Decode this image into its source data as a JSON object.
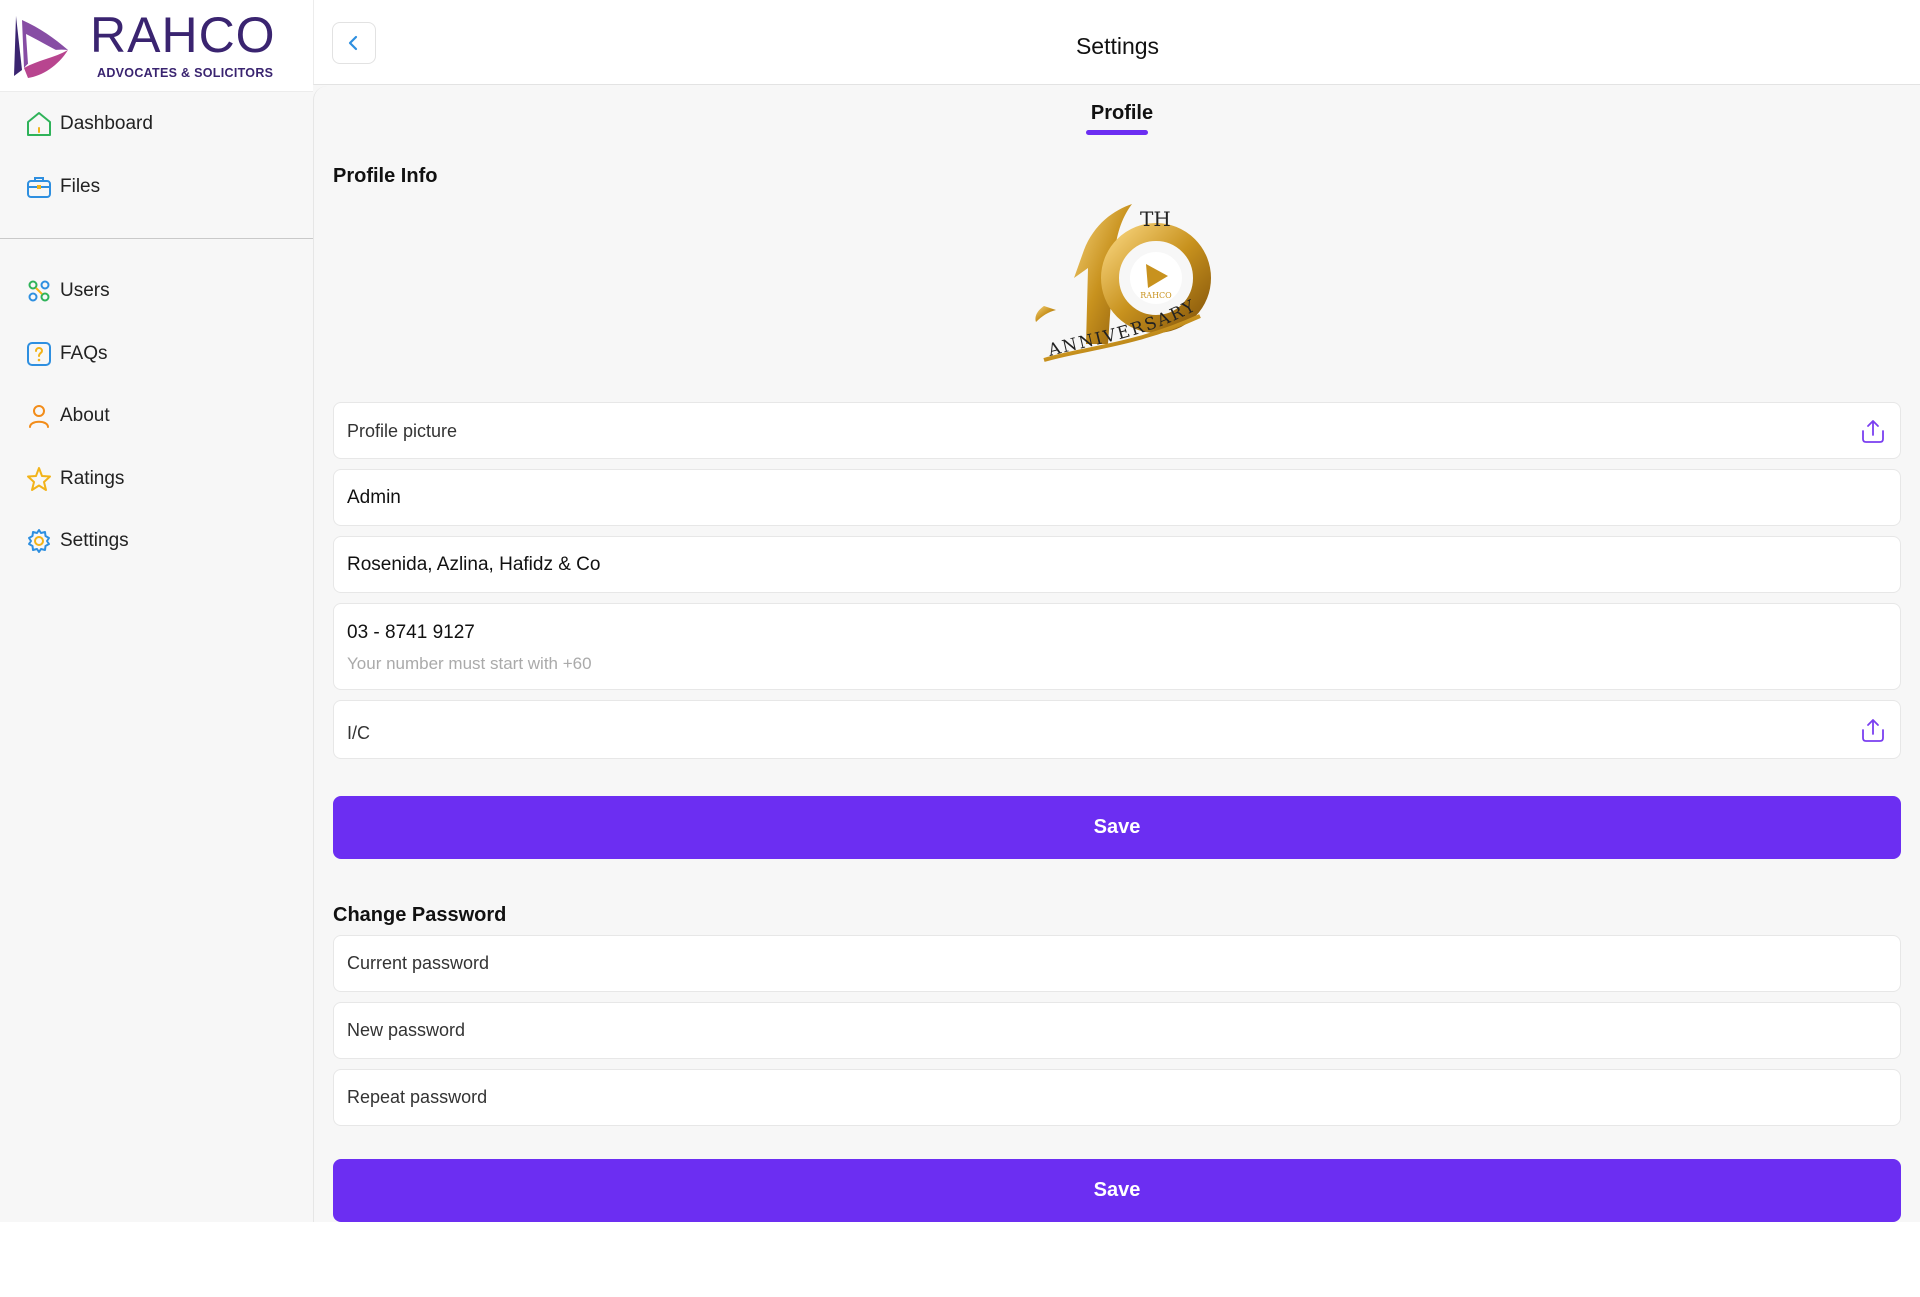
{
  "brand": {
    "name": "RAHCO",
    "subtitle": "ADVOCATES & SOLICITORS"
  },
  "sidebar": {
    "primary": [
      {
        "label": "Dashboard",
        "icon": "home-icon"
      },
      {
        "label": "Files",
        "icon": "briefcase-icon"
      }
    ],
    "secondary": [
      {
        "label": "Users",
        "icon": "users-icon"
      },
      {
        "label": "FAQs",
        "icon": "faq-icon"
      },
      {
        "label": "About",
        "icon": "person-icon"
      },
      {
        "label": "Ratings",
        "icon": "star-icon"
      },
      {
        "label": "Settings",
        "icon": "gear-icon"
      }
    ]
  },
  "header": {
    "title": "Settings"
  },
  "tabs": [
    {
      "label": "Profile",
      "active": true
    }
  ],
  "profile": {
    "section_title": "Profile Info",
    "avatar": {
      "text_top": "TH",
      "text_center": "RAHCO",
      "text_bottom": "ANNIVERSARY",
      "number": "10"
    },
    "picture_label": "Profile picture",
    "name": "Admin",
    "firm": "Rosenida, Azlina, Hafidz & Co",
    "phone": "03 - 8741 9127",
    "phone_hint": "Your number must start with +60",
    "ic_label": "I/C",
    "save_label": "Save"
  },
  "password": {
    "section_title": "Change Password",
    "current_placeholder": "Current password",
    "new_placeholder": "New password",
    "repeat_placeholder": "Repeat password",
    "save_label": "Save"
  },
  "colors": {
    "accent": "#6c2ef2",
    "brand": "#3a2470",
    "gold": "#c8921e"
  }
}
